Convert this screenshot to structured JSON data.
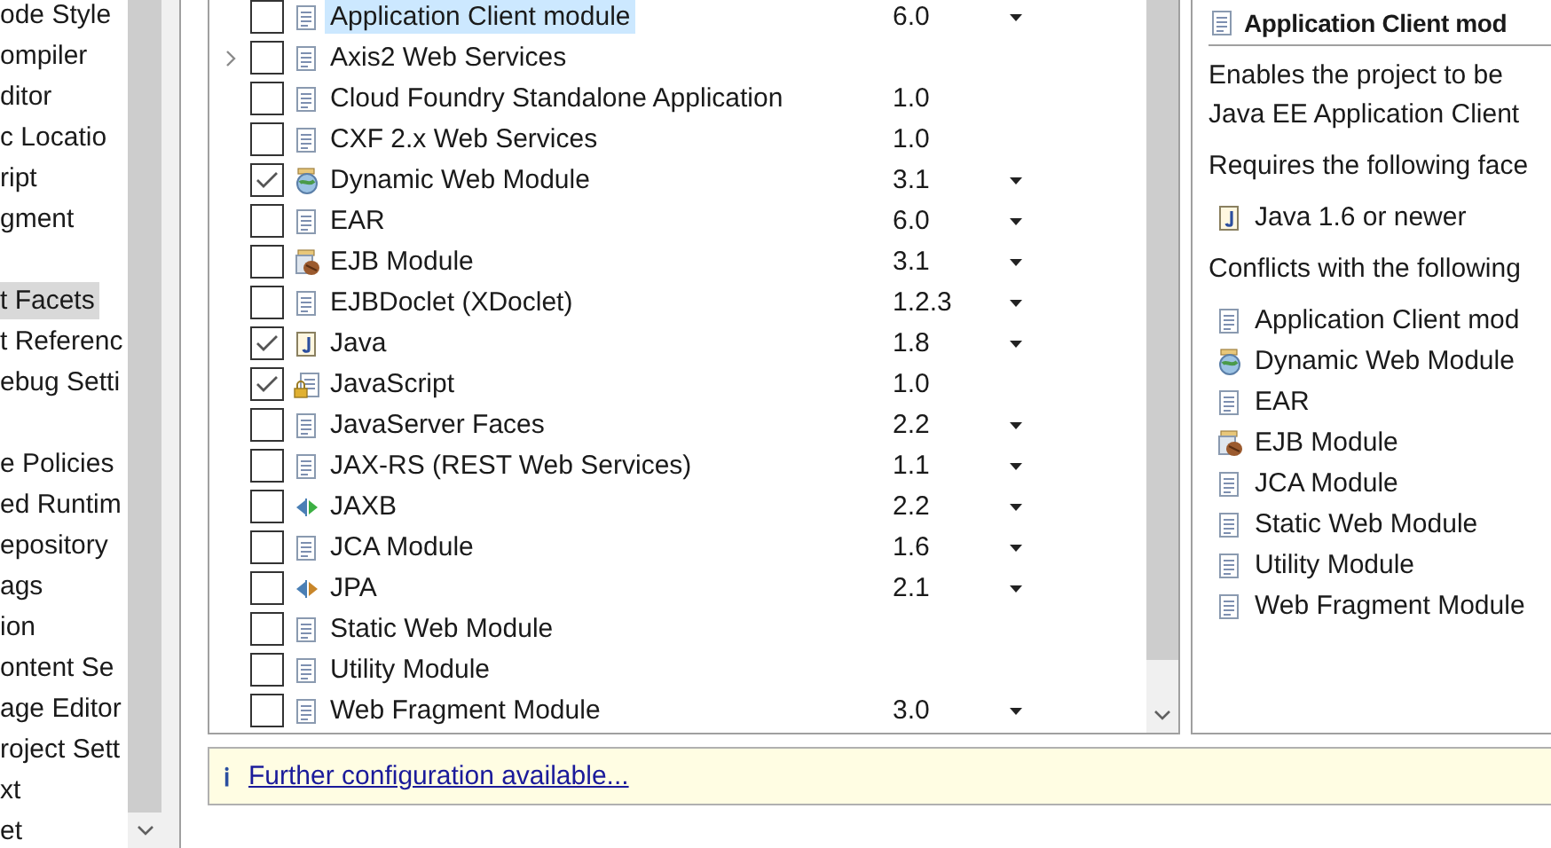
{
  "sidebar": {
    "items": [
      {
        "kind": "item",
        "label": "ode Style",
        "selected": false
      },
      {
        "kind": "item",
        "label": "ompiler",
        "selected": false
      },
      {
        "kind": "item",
        "label": "ditor",
        "selected": false
      },
      {
        "kind": "item",
        "label": "c Locatio",
        "selected": false
      },
      {
        "kind": "item",
        "label": "ript",
        "selected": false
      },
      {
        "kind": "item",
        "label": "gment",
        "selected": false
      },
      {
        "kind": "blank"
      },
      {
        "kind": "item",
        "label": "t Facets",
        "selected": true
      },
      {
        "kind": "item",
        "label": "t Referenc",
        "selected": false
      },
      {
        "kind": "item",
        "label": "ebug Setti",
        "selected": false
      },
      {
        "kind": "blank"
      },
      {
        "kind": "item",
        "label": "e Policies",
        "selected": false
      },
      {
        "kind": "item",
        "label": "ed Runtim",
        "selected": false
      },
      {
        "kind": "item",
        "label": "epository",
        "selected": false
      },
      {
        "kind": "item",
        "label": "ags",
        "selected": false
      },
      {
        "kind": "item",
        "label": "ion",
        "selected": false
      },
      {
        "kind": "item",
        "label": "ontent Se",
        "selected": false
      },
      {
        "kind": "item",
        "label": "age Editor",
        "selected": false
      },
      {
        "kind": "item",
        "label": "roject Sett",
        "selected": false
      },
      {
        "kind": "item",
        "label": "xt",
        "selected": false
      },
      {
        "kind": "item",
        "label": "et",
        "selected": false
      }
    ]
  },
  "facets": [
    {
      "kind": "doc",
      "label": "Application Client module",
      "version": "6.0",
      "dropdown": true,
      "checked": false,
      "selected": true,
      "collapsed": false
    },
    {
      "kind": "doc",
      "label": "Axis2 Web Services",
      "dropdown": false,
      "checked": false,
      "selected": false,
      "collapsed": true
    },
    {
      "kind": "doc",
      "label": "Cloud Foundry Standalone Application",
      "version": "1.0",
      "dropdown": false,
      "checked": false,
      "selected": false,
      "collapsed": false
    },
    {
      "kind": "doc",
      "label": "CXF 2.x Web Services",
      "version": "1.0",
      "dropdown": false,
      "checked": false,
      "selected": false,
      "collapsed": false
    },
    {
      "kind": "globe",
      "label": "Dynamic Web Module",
      "version": "3.1",
      "dropdown": true,
      "checked": true,
      "selected": false,
      "collapsed": false
    },
    {
      "kind": "doc",
      "label": "EAR",
      "version": "6.0",
      "dropdown": true,
      "checked": false,
      "selected": false,
      "collapsed": false
    },
    {
      "kind": "bean",
      "label": "EJB Module",
      "version": "3.1",
      "dropdown": true,
      "checked": false,
      "selected": false,
      "collapsed": false
    },
    {
      "kind": "doc",
      "label": "EJBDoclet (XDoclet)",
      "version": "1.2.3",
      "dropdown": true,
      "checked": false,
      "selected": false,
      "collapsed": false
    },
    {
      "kind": "java",
      "label": "Java",
      "version": "1.8",
      "dropdown": true,
      "checked": true,
      "selected": false,
      "collapsed": false
    },
    {
      "kind": "lockdoc",
      "label": "JavaScript",
      "version": "1.0",
      "dropdown": false,
      "checked": true,
      "selected": false,
      "collapsed": false
    },
    {
      "kind": "doc",
      "label": "JavaServer Faces",
      "version": "2.2",
      "dropdown": true,
      "checked": false,
      "selected": false,
      "collapsed": false
    },
    {
      "kind": "doc",
      "label": "JAX-RS (REST Web Services)",
      "version": "1.1",
      "dropdown": true,
      "checked": false,
      "selected": false,
      "collapsed": false
    },
    {
      "kind": "arrowsgreen",
      "label": "JAXB",
      "version": "2.2",
      "dropdown": true,
      "checked": false,
      "selected": false,
      "collapsed": false
    },
    {
      "kind": "doc",
      "label": "JCA Module",
      "version": "1.6",
      "dropdown": true,
      "checked": false,
      "selected": false,
      "collapsed": false
    },
    {
      "kind": "arrowsorange",
      "label": "JPA",
      "version": "2.1",
      "dropdown": true,
      "checked": false,
      "selected": false,
      "collapsed": false
    },
    {
      "kind": "doc",
      "label": "Static Web Module",
      "dropdown": false,
      "checked": false,
      "selected": false,
      "collapsed": false
    },
    {
      "kind": "doc",
      "label": "Utility Module",
      "dropdown": false,
      "checked": false,
      "selected": false,
      "collapsed": false
    },
    {
      "kind": "doc",
      "label": "Web Fragment Module",
      "version": "3.0",
      "dropdown": true,
      "checked": false,
      "selected": false,
      "collapsed": false
    }
  ],
  "details": {
    "title": "Application Client mod",
    "description": [
      "Enables the project to be",
      "Java EE Application Client"
    ],
    "requires_heading": "Requires the following face",
    "requires": [
      {
        "kind": "java",
        "label": "Java 1.6 or newer"
      }
    ],
    "conflicts_heading": "Conflicts with the following",
    "conflicts": [
      {
        "kind": "doc",
        "label": "Application Client mod"
      },
      {
        "kind": "globe",
        "label": "Dynamic Web Module"
      },
      {
        "kind": "doc",
        "label": "EAR"
      },
      {
        "kind": "bean",
        "label": "EJB Module"
      },
      {
        "kind": "doc",
        "label": "JCA Module"
      },
      {
        "kind": "doc",
        "label": "Static Web Module"
      },
      {
        "kind": "doc",
        "label": "Utility Module"
      },
      {
        "kind": "doc",
        "label": "Web Fragment Module"
      }
    ]
  },
  "info_bar": {
    "icon": "ℹ",
    "link": "Further configuration available..."
  }
}
